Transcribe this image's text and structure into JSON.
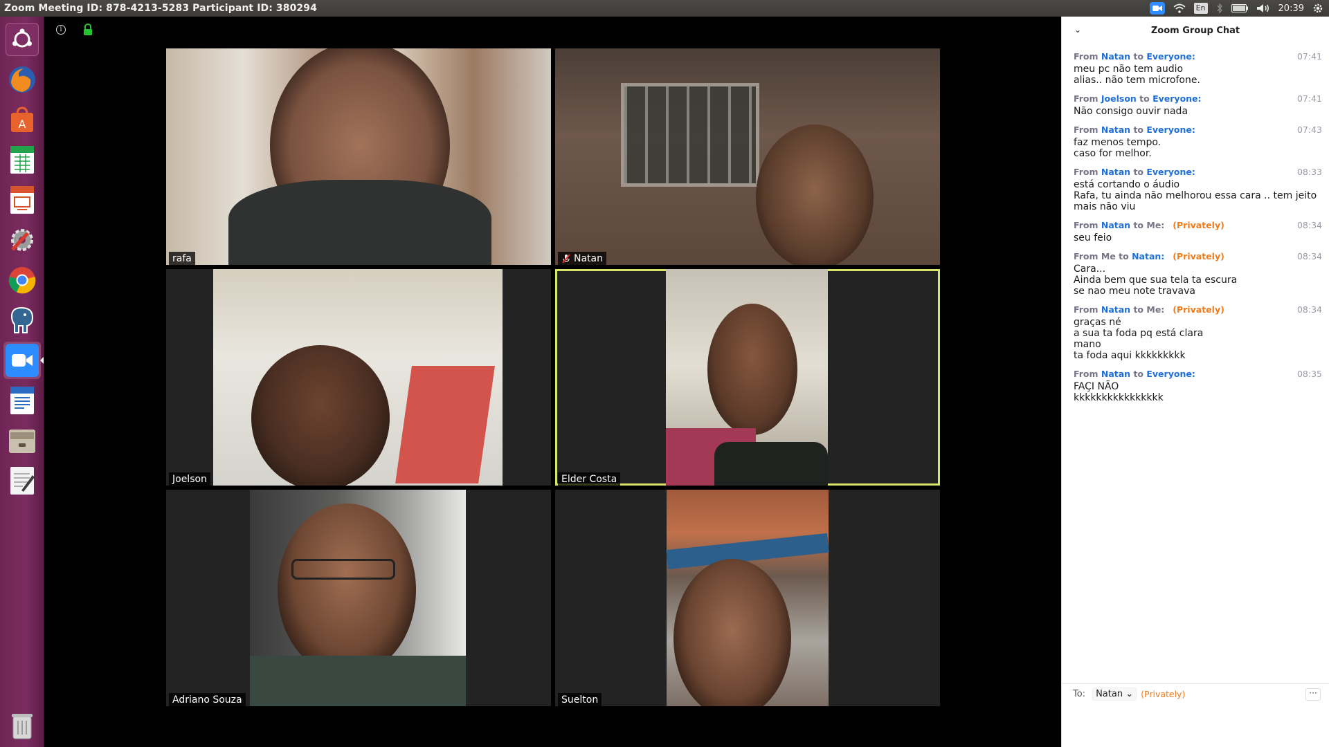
{
  "window": {
    "title": "Zoom Meeting ID: 878-4213-5283 Participant ID: 380294"
  },
  "tray": {
    "language": "En",
    "time": "20:39"
  },
  "launcher": {
    "items": [
      "ubuntu-dash",
      "firefox",
      "software-center",
      "spreadsheet",
      "presentation",
      "settings",
      "chrome",
      "postgres",
      "zoom",
      "writer",
      "archive",
      "text-editor",
      "trash"
    ]
  },
  "participants": [
    {
      "name": "rafa",
      "muted": false,
      "active": false
    },
    {
      "name": "Natan",
      "muted": true,
      "active": false
    },
    {
      "name": "Joelson",
      "muted": false,
      "active": false
    },
    {
      "name": "Elder Costa",
      "muted": false,
      "active": true
    },
    {
      "name": "Adriano Souza",
      "muted": false,
      "active": false
    },
    {
      "name": "Suelton",
      "muted": false,
      "active": false
    }
  ],
  "chat": {
    "title": "Zoom Group Chat",
    "messages": [
      {
        "from": "Natan",
        "to": "Everyone:",
        "privately": "",
        "time": "07:41",
        "lines": [
          "meu pc não tem audio",
          "alias.. não tem microfone."
        ]
      },
      {
        "from": "Joelson",
        "to": "Everyone:",
        "privately": "",
        "time": "07:41",
        "lines": [
          "Não consigo ouvir nada"
        ]
      },
      {
        "from": "Natan",
        "to": "Everyone:",
        "privately": "",
        "time": "07:43",
        "lines": [
          "faz menos tempo.",
          "caso for melhor."
        ]
      },
      {
        "from": "Natan",
        "to": "Everyone:",
        "privately": "",
        "time": "08:33",
        "lines": [
          "está cortando o áudio",
          "Rafa, tu ainda não melhorou essa cara .. tem jeito",
          "mais não viu"
        ]
      },
      {
        "from": "Natan",
        "to": "Me:",
        "privately": "(Privately)",
        "time": "08:34",
        "lines": [
          "seu feio"
        ]
      },
      {
        "from": "Me",
        "to": "Natan:",
        "privately": "(Privately)",
        "time": "08:34",
        "lines": [
          "Cara...",
          "Ainda bem que sua tela ta escura",
          "se nao meu note travava"
        ]
      },
      {
        "from": "Natan",
        "to": "Me:",
        "privately": "(Privately)",
        "time": "08:34",
        "lines": [
          "graças né",
          "a sua ta foda pq está clara",
          "mano",
          "ta foda aqui kkkkkkkkk"
        ]
      },
      {
        "from": "Natan",
        "to": "Everyone:",
        "privately": "",
        "time": "08:35",
        "lines": [
          "FAÇI NÃO",
          "kkkkkkkkkkkkkkkk"
        ]
      }
    ],
    "footer": {
      "to_label": "To:",
      "recipient": "Natan",
      "privately": "(Privately)",
      "more": "···"
    }
  }
}
